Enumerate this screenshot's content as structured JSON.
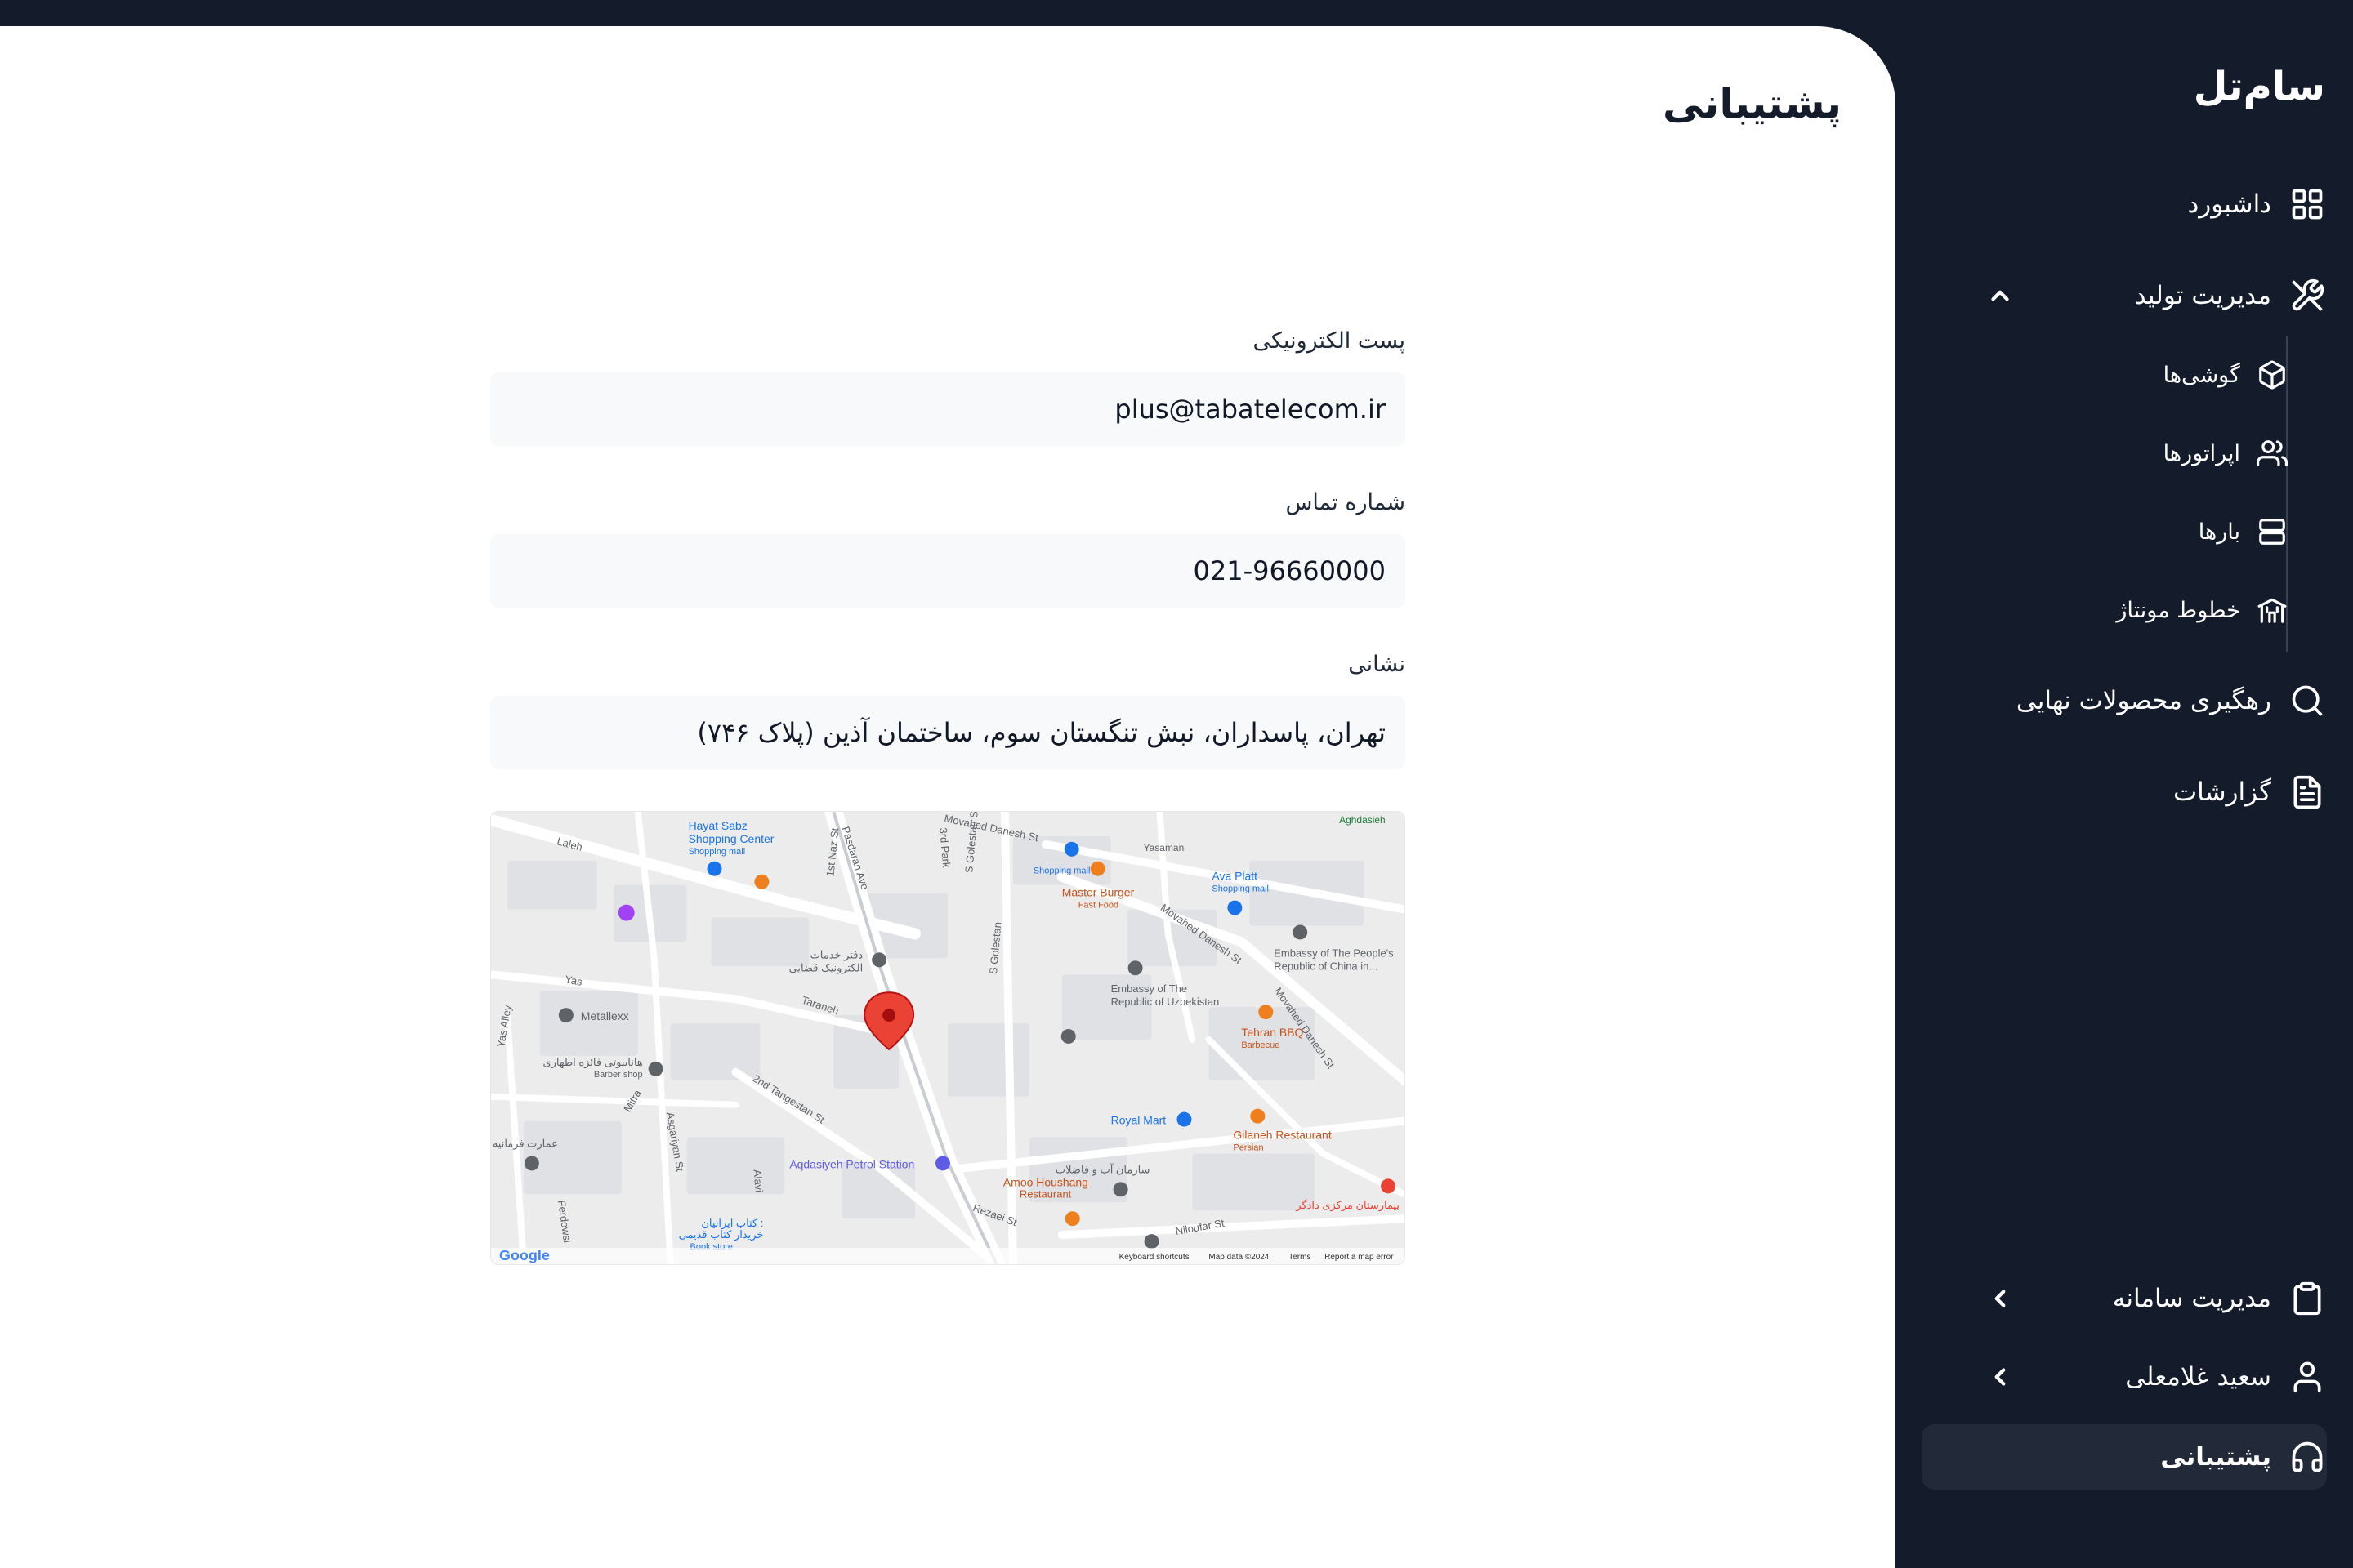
{
  "app": {
    "brand": "سام‌تل"
  },
  "sidebar": {
    "items": [
      {
        "label": "داشبورد",
        "icon": "dashboard-grid-icon"
      },
      {
        "label": "مدیریت تولید",
        "icon": "tools-icon",
        "expanded": true,
        "children": [
          {
            "label": "گوشی‌ها",
            "icon": "box-icon"
          },
          {
            "label": "اپراتورها",
            "icon": "users-icon"
          },
          {
            "label": "بارها",
            "icon": "server-icon"
          },
          {
            "label": "خطوط مونتاژ",
            "icon": "assembly-line-icon"
          }
        ]
      },
      {
        "label": "رهگیری محصولات نهایی",
        "icon": "search-icon"
      },
      {
        "label": "گزارشات",
        "icon": "document-icon"
      }
    ],
    "bottom_items": [
      {
        "label": "مدیریت سامانه",
        "icon": "clipboard-icon"
      },
      {
        "label": "سعید غلامعلی",
        "icon": "user-icon"
      },
      {
        "label": "پشتیبانی",
        "icon": "headphones-icon",
        "active": true
      }
    ]
  },
  "page": {
    "title": "پشتیبانی",
    "email": {
      "label": "پست الکترونیکی",
      "value": "plus@tabatelecom.ir"
    },
    "phone": {
      "label": "شماره تماس",
      "value": "021-96660000"
    },
    "address": {
      "label": "نشانی",
      "value": "تهران، پاسداران، نبش تنگستان سوم، ساختمان آذین (پلاک ۷۴۶)"
    }
  },
  "map": {
    "labels": {
      "laleh": "Laleh",
      "hayat_sabz": "Hayat Sabz",
      "hayat_sabz2": "Shopping Center",
      "shopping_mall": "Shopping mall",
      "pasdaran_ave": "Pasdaran Ave",
      "first_naz": "1st Naz St",
      "third_park": "3rd Park",
      "movahed_danesh": "Movahed Danesh St",
      "s_golestan": "S Golestan St",
      "shopping_mall2": "Shopping mall",
      "master_burger": "Master Burger",
      "fast_food": "Fast Food",
      "yasaman": "Yasaman",
      "ava_platt": "Ava Platt",
      "shopping_mall3": "Shopping mall",
      "agdasieh": "Aghdasieh",
      "movahed_danesh2": "Movahed Danesh St",
      "embassy_china": "Embassy of The People's",
      "embassy_china2": "Republic of China in...",
      "daftar_khadamat": "دفتر خدمات",
      "daftar_khadamat2": "الکترونیک قضایی",
      "taraneh": "Taraneh",
      "embassy_uzb": "Embassy of The",
      "embassy_uzb2": "Republic of Uzbekistan",
      "s_golestan2": "S Golestan",
      "yas": "Yas",
      "metallexx": "Metallexx",
      "yas_alley": "Yas Alley",
      "barber": "هانابیوتی فائزه اطهاری",
      "barber2": "Barber shop",
      "tehran_bbq": "Tehran BBQ",
      "barbecue": "Barbecue",
      "movahed_danesh3": "Movahed Danesh St",
      "second_tangestan": "2nd Tangestan St",
      "mitra": "Mitra",
      "asgariyan": "Asgariyan St",
      "royal_mart": "Royal Mart",
      "gilaneh": "Gilaneh Restaurant",
      "persian": "Persian",
      "alavi": "Alavi",
      "aqdasiyeh_petrol": "Aqdasiyeh Petrol Station",
      "amoo_houshang": "Amoo Houshang",
      "restaurant": "Restaurant",
      "water_org": "سازمان آب و فاضلاب",
      "rezaei": "Rezaei St",
      "niloufar": "Niloufar St",
      "ferdowsi": "Ferdowsi",
      "book_store": "کتاب ایرانیان :",
      "book_store2": "خریدار کتاب قدیمی",
      "book_store3": "Book store",
      "emarat": "عمارت فرمانیه",
      "hospital": "بیمارستان مرکزی دادگر",
      "google": "Google",
      "keyboard_shortcuts": "Keyboard shortcuts",
      "map_data": "Map data ©2024",
      "terms": "Terms",
      "report": "Report a map error"
    }
  }
}
